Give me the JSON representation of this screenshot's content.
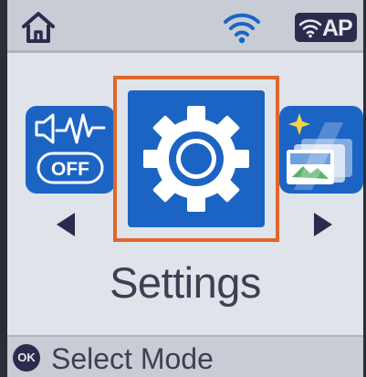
{
  "status_bar": {
    "home_icon": "home-icon",
    "wifi_icon": "wifi-icon",
    "ap_badge_label": "AP"
  },
  "carousel": {
    "items": [
      {
        "icon": "sound-off-icon",
        "badge": "OFF",
        "state": "adjacent"
      },
      {
        "icon": "gear-icon",
        "label": "Settings",
        "state": "selected"
      },
      {
        "icon": "card-photo-icon",
        "state": "adjacent"
      }
    ],
    "prev_icon": "arrow-left-icon",
    "next_icon": "arrow-right-icon",
    "selected_label": "Settings"
  },
  "bottom_bar": {
    "button_label": "OK",
    "hint": "Select Mode"
  },
  "colors": {
    "tile_blue": "#1c64c4",
    "selection_orange": "#e0662b",
    "screen_bg": "#dfe3ea",
    "bar_bg": "#c7ccd5",
    "text_dark": "#3c4052"
  }
}
